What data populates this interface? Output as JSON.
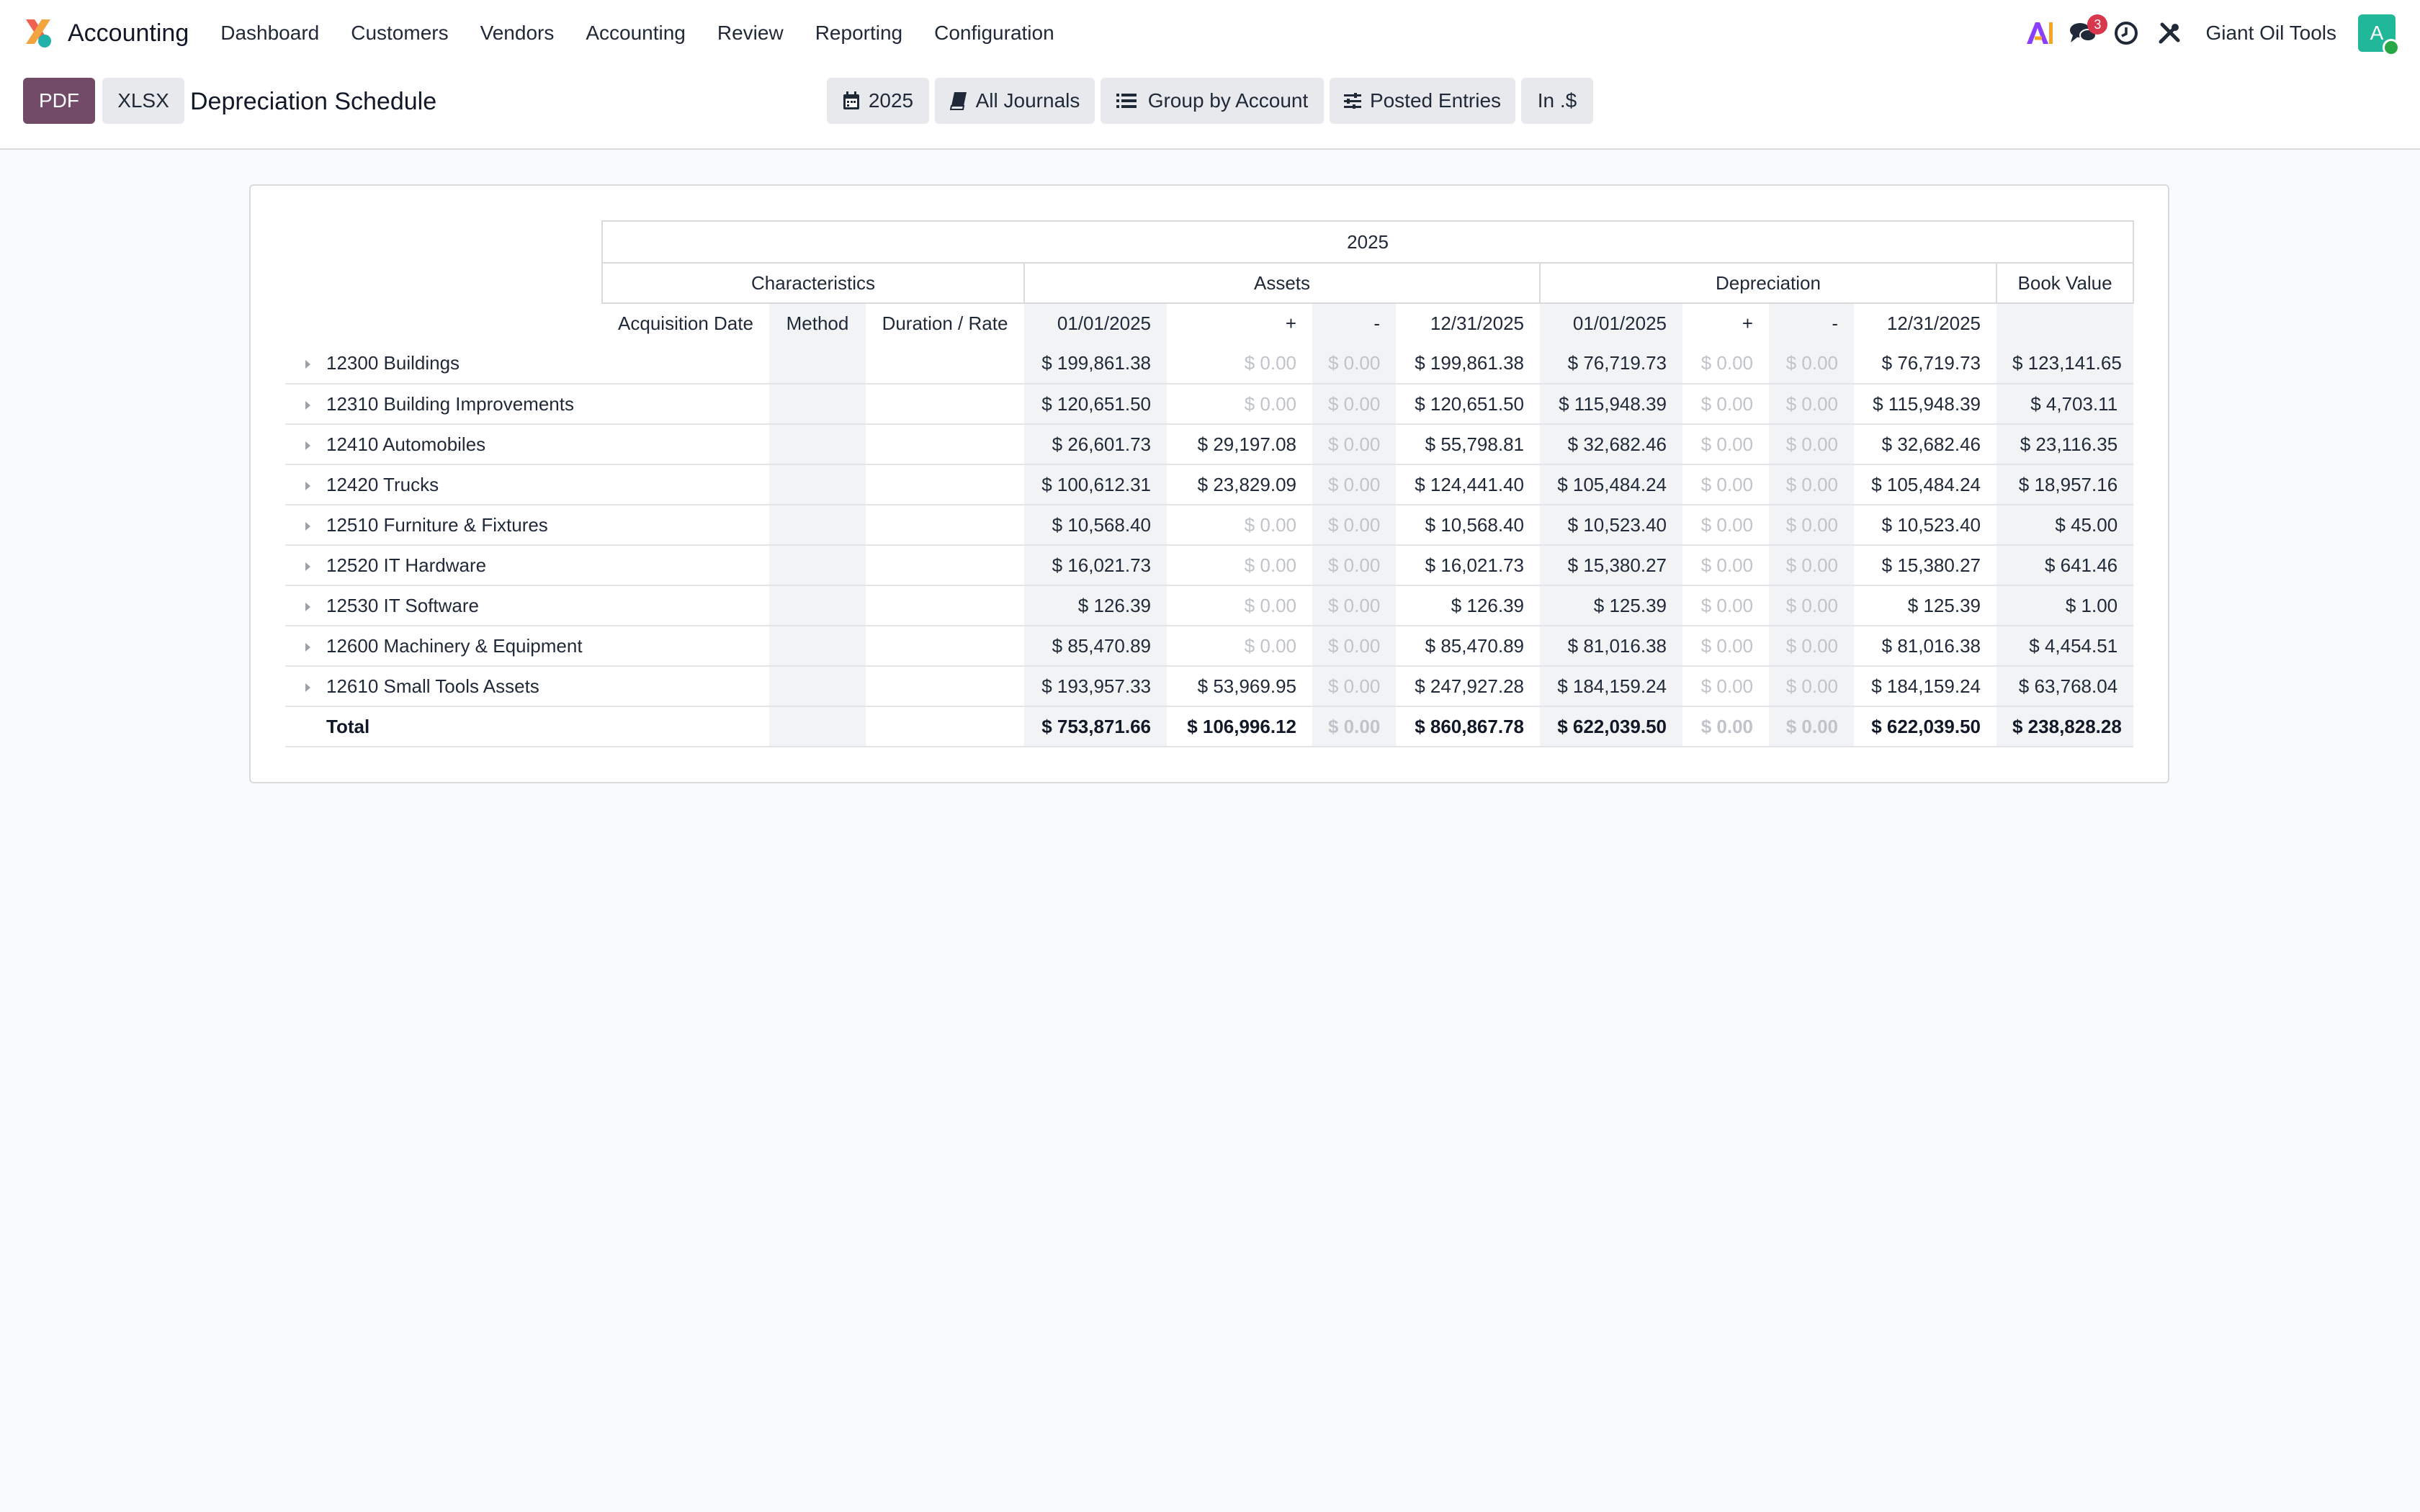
{
  "navbar": {
    "app_name": "Accounting",
    "menu": [
      "Dashboard",
      "Customers",
      "Vendors",
      "Accounting",
      "Review",
      "Reporting",
      "Configuration"
    ],
    "messages_count": "3",
    "avatar_letter": "A",
    "company": "Giant Oil Tools",
    "icons": [
      "ai-icon",
      "chat-icon",
      "clock-icon",
      "tools-icon"
    ]
  },
  "control": {
    "pdf_label": "PDF",
    "xlsx_label": "XLSX",
    "title": "Depreciation Schedule",
    "filters": [
      {
        "label": "2025",
        "icon": "calendar-icon"
      },
      {
        "label": "All Journals",
        "icon": "book-icon"
      },
      {
        "label": "Group by Account",
        "icon": "list-icon"
      },
      {
        "label": "Posted Entries",
        "icon": "sliders-icon"
      },
      {
        "label": "In .$",
        "icon": ""
      }
    ]
  },
  "report": {
    "year": "2025",
    "groups": {
      "characteristics": "Characteristics",
      "assets": "Assets",
      "depreciation": "Depreciation",
      "book_value": "Book Value"
    },
    "columns": [
      "Acquisition Date",
      "Method",
      "Duration / Rate",
      "01/01/2025",
      "+",
      "-",
      "12/31/2025",
      "01/01/2025",
      "+",
      "-",
      "12/31/2025"
    ],
    "rows": [
      {
        "name": "12300 Buildings",
        "values": [
          "$ 199,861.38",
          "$ 0.00",
          "$ 0.00",
          "$ 199,861.38",
          "$ 76,719.73",
          "$ 0.00",
          "$ 0.00",
          "$ 76,719.73",
          "$ 123,141.65"
        ]
      },
      {
        "name": "12310 Building Improvements",
        "values": [
          "$ 120,651.50",
          "$ 0.00",
          "$ 0.00",
          "$ 120,651.50",
          "$ 115,948.39",
          "$ 0.00",
          "$ 0.00",
          "$ 115,948.39",
          "$ 4,703.11"
        ]
      },
      {
        "name": "12410 Automobiles",
        "values": [
          "$ 26,601.73",
          "$ 29,197.08",
          "$ 0.00",
          "$ 55,798.81",
          "$ 32,682.46",
          "$ 0.00",
          "$ 0.00",
          "$ 32,682.46",
          "$ 23,116.35"
        ]
      },
      {
        "name": "12420 Trucks",
        "values": [
          "$ 100,612.31",
          "$ 23,829.09",
          "$ 0.00",
          "$ 124,441.40",
          "$ 105,484.24",
          "$ 0.00",
          "$ 0.00",
          "$ 105,484.24",
          "$ 18,957.16"
        ]
      },
      {
        "name": "12510 Furniture & Fixtures",
        "values": [
          "$ 10,568.40",
          "$ 0.00",
          "$ 0.00",
          "$ 10,568.40",
          "$ 10,523.40",
          "$ 0.00",
          "$ 0.00",
          "$ 10,523.40",
          "$ 45.00"
        ]
      },
      {
        "name": "12520 IT Hardware",
        "values": [
          "$ 16,021.73",
          "$ 0.00",
          "$ 0.00",
          "$ 16,021.73",
          "$ 15,380.27",
          "$ 0.00",
          "$ 0.00",
          "$ 15,380.27",
          "$ 641.46"
        ]
      },
      {
        "name": "12530 IT Software",
        "values": [
          "$ 126.39",
          "$ 0.00",
          "$ 0.00",
          "$ 126.39",
          "$ 125.39",
          "$ 0.00",
          "$ 0.00",
          "$ 125.39",
          "$ 1.00"
        ]
      },
      {
        "name": "12600 Machinery & Equipment",
        "values": [
          "$ 85,470.89",
          "$ 0.00",
          "$ 0.00",
          "$ 85,470.89",
          "$ 81,016.38",
          "$ 0.00",
          "$ 0.00",
          "$ 81,016.38",
          "$ 4,454.51"
        ]
      },
      {
        "name": "12610 Small Tools Assets",
        "values": [
          "$ 193,957.33",
          "$ 53,969.95",
          "$ 0.00",
          "$ 247,927.28",
          "$ 184,159.24",
          "$ 0.00",
          "$ 0.00",
          "$ 184,159.24",
          "$ 63,768.04"
        ]
      }
    ],
    "total": {
      "name": "Total",
      "values": [
        "$ 753,871.66",
        "$ 106,996.12",
        "$ 0.00",
        "$ 860,867.78",
        "$ 622,039.50",
        "$ 0.00",
        "$ 0.00",
        "$ 622,039.50",
        "$ 238,828.28"
      ]
    }
  }
}
